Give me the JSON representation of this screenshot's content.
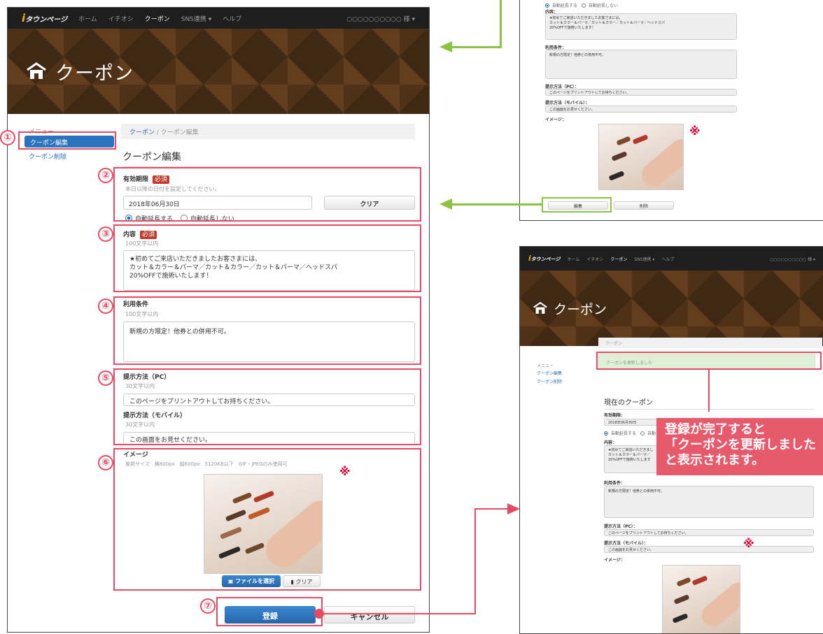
{
  "nav": {
    "logo": "タウンページ",
    "items": [
      "ホーム",
      "イチオシ",
      "クーポン",
      "SNS連携 ▾",
      "ヘルプ"
    ],
    "user": "○○○○○○○○○○ 様 ▾"
  },
  "hero": {
    "title": "クーポン"
  },
  "sidebar": {
    "title": "メニュー",
    "items": [
      "クーポン編集",
      "クーポン削除"
    ]
  },
  "breadcrumb": {
    "link": "クーポン",
    "current": "クーポン編集"
  },
  "form": {
    "heading": "クーポン編集",
    "required": "必須",
    "period": {
      "label": "有効期限",
      "hint": "本日以降の日付を設定してください。",
      "value": "2018年06月30日",
      "clear": "クリア",
      "radio_on": "自動延長する",
      "radio_off": "自動延長しない"
    },
    "content": {
      "label": "内容",
      "hint": "100文字以内",
      "line1": "★初めてご来店いただきましたお客さまには、",
      "line2": "カット＆カラー＆パーマ／カット＆カラー／カット＆パーマ／ヘッドスパ",
      "line3": "20%OFFで施術いたします！"
    },
    "terms": {
      "label": "利用条件",
      "hint": "100文字以内",
      "value": "新規の方限定！他券との併用不可。"
    },
    "pc": {
      "label": "提示方法（PC）",
      "hint": "30文字以内",
      "value": "このページをプリントアウトしてお持ちください。"
    },
    "mobile": {
      "label": "提示方法（モバイル）",
      "hint": "30文字以内",
      "value": "この画面をお見せください。"
    },
    "image": {
      "label": "イメージ",
      "hint": "推奨サイズ　横800px　縦600px　5120KB以下　GIF・JPEGのみ使用可",
      "select": "ファイルを選択",
      "clear": "クリア"
    },
    "submit": "登録",
    "cancel": "キャンセル"
  },
  "annotations": [
    "①",
    "②",
    "③",
    "④",
    "⑤",
    "⑥",
    "⑦"
  ],
  "asterisk": "※",
  "preview": {
    "radio_on": "自動延長する",
    "radio_off": "自動延長しない",
    "content_label": "内容：",
    "content1": "★初めてご来店いただきましたお客さまには、",
    "content2": "カット＆カラー＆パーマ／カット＆カラー／カット＆パーマ／ヘッドスパ",
    "content3": "20%OFFで施術いたします！",
    "terms_label": "利用条件：",
    "terms_value": "新規の方限定！他券との併用不可。",
    "pc_label": "提示方法（PC）：",
    "pc_value": "このページをプリントアウトしてお持ちください。",
    "mobile_label": "提示方法（モバイル）：",
    "mobile_value": "この画面をお見せください。",
    "image_label": "イメージ：",
    "edit_button": "編集",
    "delete_button": "削除"
  },
  "result": {
    "breadcrumb": "クーポン",
    "success": "クーポンを更新しました",
    "heading": "現在のクーポン",
    "period_label": "有効期限：",
    "period_value": "2018年06月30日",
    "radio_on": "自動延長する",
    "radio_off": "自動",
    "content_label": "内容：",
    "content1": "★初めてご来店いただきまし",
    "content2": "カット＆カラー＆パーマ／",
    "content3": "20%OFFで施術いたします",
    "terms_label": "利用条件：",
    "terms_value": "新規の方限定！他券との併用不可。",
    "pc_label": "提示方法（PC）：",
    "pc_value": "このページをプリントアウトしてお持ちください。",
    "mobile_label": "提示方法（モバイル）：",
    "mobile_value": "この画面をお見せください。",
    "image_label": "イメージ："
  },
  "callout": {
    "line1": "登録が完了すると",
    "line2": "「クーポンを更新しました",
    "line3": "と表示されます。"
  }
}
